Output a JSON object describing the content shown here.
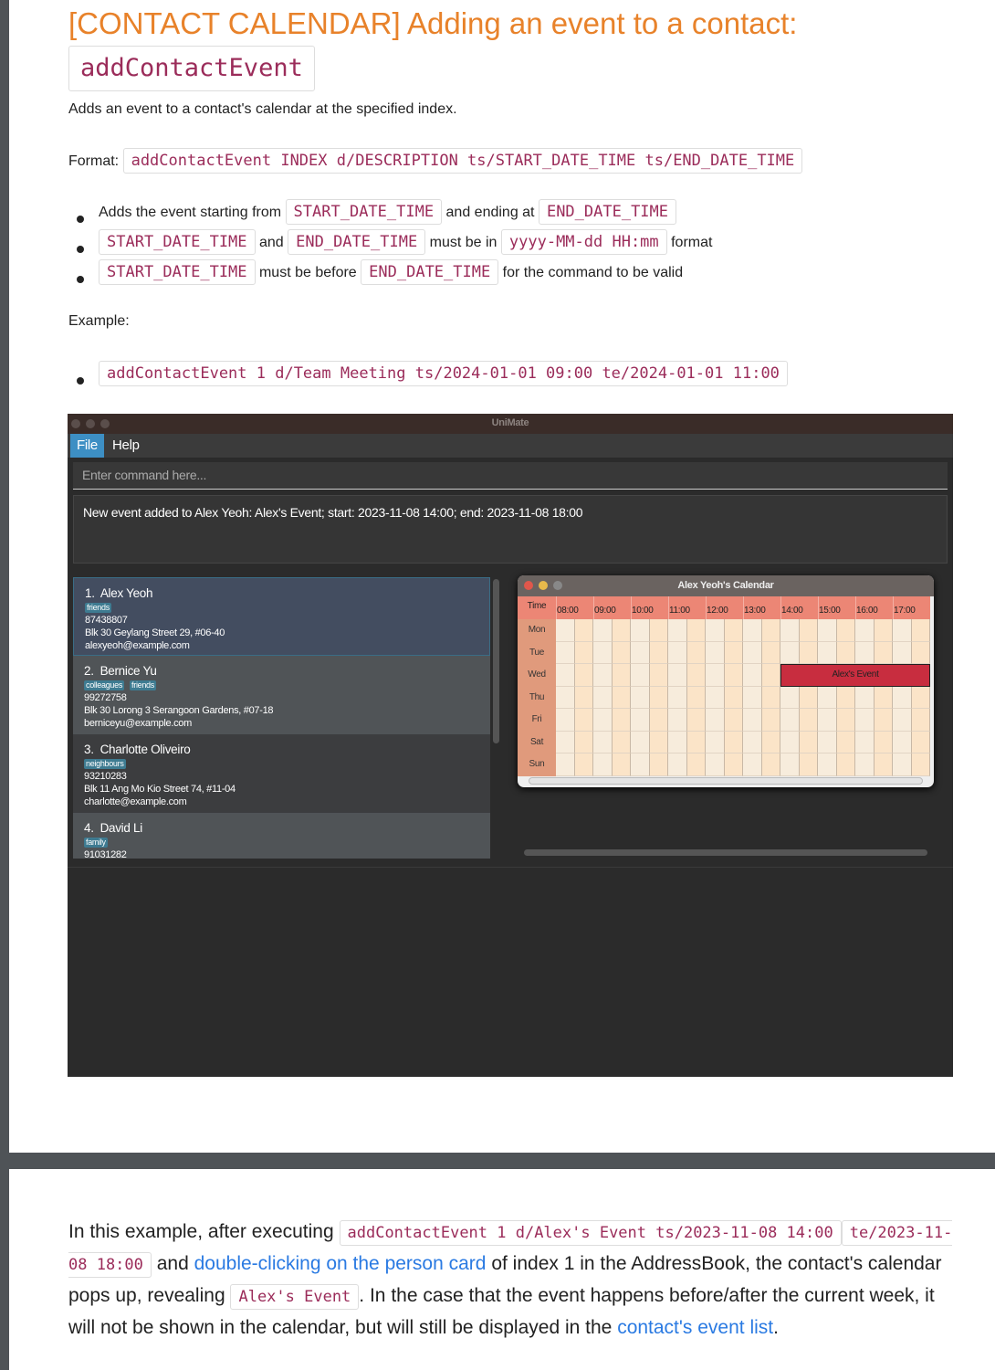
{
  "heading": {
    "title": "[CONTACT CALENDAR] Adding an event to a contact:",
    "command": "addContactEvent"
  },
  "intro": "Adds an event to a contact's calendar at the specified index.",
  "format": {
    "label": "Format:",
    "code": "addContactEvent INDEX d/DESCRIPTION ts/START_DATE_TIME ts/END_DATE_TIME"
  },
  "bullets": [
    [
      "Adds the event starting from ",
      {
        "c": "START_DATE_TIME"
      },
      " and ending at ",
      {
        "c": "END_DATE_TIME"
      }
    ],
    [
      {
        "c": "START_DATE_TIME"
      },
      " and ",
      {
        "c": "END_DATE_TIME"
      },
      " must be in ",
      {
        "c": "yyyy-MM-dd HH:mm"
      },
      " format"
    ],
    [
      {
        "c": "START_DATE_TIME"
      },
      " must be before ",
      {
        "c": "END_DATE_TIME"
      },
      " for the command to be valid"
    ]
  ],
  "example": {
    "label": "Example:",
    "code": "addContactEvent 1 d/Team Meeting ts/2024-01-01 09:00 te/2024-01-01 11:00"
  },
  "app": {
    "title": "UniMate",
    "menu": [
      "File",
      "Help"
    ],
    "command_placeholder": "Enter command here...",
    "result": "New event added to Alex Yeoh: Alex's Event; start: 2023-11-08 14:00; end: 2023-11-08 18:00",
    "persons": [
      {
        "index": "1.",
        "name": "Alex Yeoh",
        "tags": [
          "friends"
        ],
        "phone": "87438807",
        "address": "Blk 30 Geylang Street 29, #06-40",
        "email": "alexyeoh@example.com",
        "selected": true
      },
      {
        "index": "2.",
        "name": "Bernice Yu",
        "tags": [
          "colleagues",
          "friends"
        ],
        "phone": "99272758",
        "address": "Blk 30 Lorong 3 Serangoon Gardens, #07-18",
        "email": "berniceyu@example.com"
      },
      {
        "index": "3.",
        "name": "Charlotte Oliveiro",
        "tags": [
          "neighbours"
        ],
        "phone": "93210283",
        "address": "Blk 11 Ang Mo Kio Street 74, #11-04",
        "email": "charlotte@example.com"
      },
      {
        "index": "4.",
        "name": "David Li",
        "tags": [
          "family"
        ],
        "phone": "91031282",
        "address": "",
        "email": ""
      }
    ],
    "calendar": {
      "title": "Alex Yeoh's Calendar",
      "corner": "Time",
      "hours": [
        "08:00",
        "09:00",
        "10:00",
        "11:00",
        "12:00",
        "13:00",
        "14:00",
        "15:00",
        "16:00",
        "17:00"
      ],
      "days": [
        "Mon",
        "Tue",
        "Wed",
        "Thu",
        "Fri",
        "Sat",
        "Sun"
      ],
      "event": {
        "label": "Alex's Event",
        "day": "Wed",
        "start": "14:00",
        "end": "18:00",
        "color": "#c82d3f"
      }
    }
  },
  "explanation": {
    "parts": [
      "In this example, after executing ",
      {
        "c": "addContactEvent 1 d/Alex's Event ts/2023-11-08 14:00"
      },
      {
        "c": "te/2023-11-08 18:00"
      },
      " and ",
      {
        "a": "double-clicking on the person card"
      },
      " of index 1 in the AddressBook, the contact's calendar pops up, revealing ",
      {
        "c": "Alex's Event"
      },
      ". In the case that the event happens before/after the current week, it will not be shown in the calendar, but will still be displayed in the ",
      {
        "a": "contact's event list"
      },
      "."
    ]
  },
  "colors": {
    "heading": "#e8822a",
    "code": "#9b2c5a",
    "link": "#2a7ae2",
    "selected_card": "#434d60",
    "tag": "#3e7b91",
    "calendar_header": "#ec8675"
  }
}
